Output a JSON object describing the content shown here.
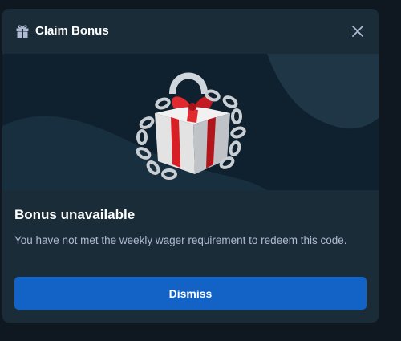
{
  "modal": {
    "title": "Claim Bonus",
    "title_icon": "gift-icon",
    "close_icon": "close-icon"
  },
  "banner": {
    "image": "locked-gift-chained-illustration"
  },
  "content": {
    "heading": "Bonus unavailable",
    "message": "You have not met the weekly wager requirement to redeem this code."
  },
  "actions": {
    "dismiss_label": "Dismiss"
  },
  "colors": {
    "modal_bg": "#1a2c38",
    "banner_bg": "#0f212e",
    "accent_button": "#1363c6",
    "text_primary": "#ffffff",
    "text_secondary": "#b1bad3"
  }
}
